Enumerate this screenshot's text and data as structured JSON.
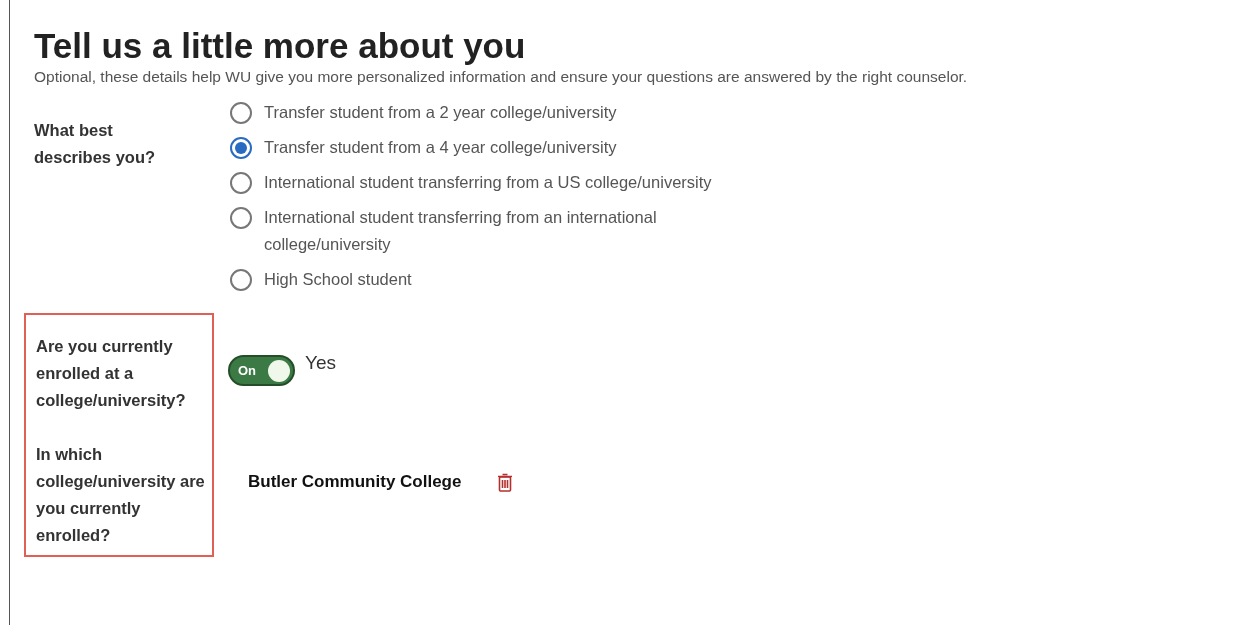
{
  "title": "Tell us a little more about you",
  "subtitle": "Optional, these details help WU give you more personalized information and ensure your questions are answered by the right counselor.",
  "describe": {
    "label": "What best describes you?",
    "options": [
      {
        "label": "Transfer student from a 2 year college/university",
        "selected": false
      },
      {
        "label": "Transfer student from a 4 year college/university",
        "selected": true
      },
      {
        "label": "International student transferring from a US college/university",
        "selected": false
      },
      {
        "label": "International student transferring from an international college/university",
        "selected": false
      },
      {
        "label": "High School student",
        "selected": false
      }
    ]
  },
  "enrolled": {
    "label": "Are you currently enrolled at a college/university?",
    "toggle": {
      "on": true,
      "text": "On"
    },
    "answer": "Yes"
  },
  "college": {
    "label": "In which college/university are you currently enrolled?",
    "value": "Butler Community College"
  }
}
